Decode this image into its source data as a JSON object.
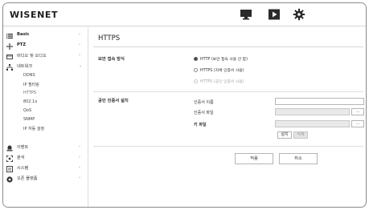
{
  "header": {
    "logo": "WISENET",
    "icons": [
      "monitor-icon",
      "play-icon",
      "gear-icon"
    ]
  },
  "sidebar": {
    "items": [
      {
        "label": "Basic",
        "icon": "list-icon",
        "arrow": "‹"
      },
      {
        "label": "PTZ",
        "icon": "ptz-move-icon",
        "arrow": "‹"
      },
      {
        "label": "비디오 및 오디오",
        "icon": "video-icon",
        "arrow": "‹"
      },
      {
        "label": "네트워크",
        "icon": "network-icon",
        "arrow": "⌄"
      },
      {
        "label": "이벤트",
        "icon": "event-icon",
        "arrow": "‹"
      },
      {
        "label": "분석",
        "icon": "analytics-icon",
        "arrow": "‹"
      },
      {
        "label": "시스템",
        "icon": "system-icon",
        "arrow": "‹"
      },
      {
        "label": "오픈 플랫폼",
        "icon": "open-platform-icon",
        "arrow": "‹"
      }
    ],
    "network_sub": [
      "DDNS",
      "IP 필터링",
      "HTTPS",
      "802.1x",
      "QoS",
      "SNMP",
      "IP 자동 설정"
    ],
    "active_sub": "HTTPS"
  },
  "main": {
    "title": "HTTPS",
    "secure_mode": {
      "label": "보안 접속 방식",
      "options": [
        {
          "label": "HTTP (보안 접속 사용 안 함)",
          "selected": true,
          "disabled": false
        },
        {
          "label": "HTTPS (자체 인증서 사용)",
          "selected": false,
          "disabled": false
        },
        {
          "label": "HTTPS (공인 인증서 사용)",
          "selected": false,
          "disabled": true
        }
      ]
    },
    "cert_install": {
      "label": "공인 인증서 설치",
      "name_label": "인증서 이름",
      "name_value": "",
      "cert_file_label": "인증서 파일",
      "key_file_label": "키 파일",
      "browse_label": "...",
      "install_label": "설치",
      "delete_label": "삭제"
    },
    "actions": {
      "apply": "적용",
      "cancel": "취소"
    }
  }
}
